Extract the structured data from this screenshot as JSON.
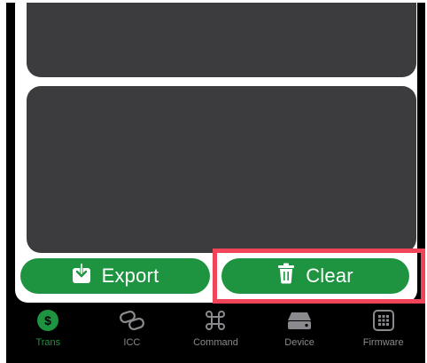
{
  "colors": {
    "accent": "#1e9441",
    "panel": "#3c3c3e",
    "inactive": "#8a8a8e",
    "highlight": "#f04458"
  },
  "actions": {
    "export_label": "Export",
    "export_icon": "download-tray-icon",
    "clear_label": "Clear",
    "clear_icon": "trash-icon"
  },
  "tabs": [
    {
      "label": "Trans",
      "icon": "dollar-circle-icon",
      "active": true
    },
    {
      "label": "ICC",
      "icon": "link-icon",
      "active": false
    },
    {
      "label": "Command",
      "icon": "command-key-icon",
      "active": false
    },
    {
      "label": "Device",
      "icon": "drive-icon",
      "active": false
    },
    {
      "label": "Firmware",
      "icon": "grid-chip-icon",
      "active": false
    }
  ]
}
